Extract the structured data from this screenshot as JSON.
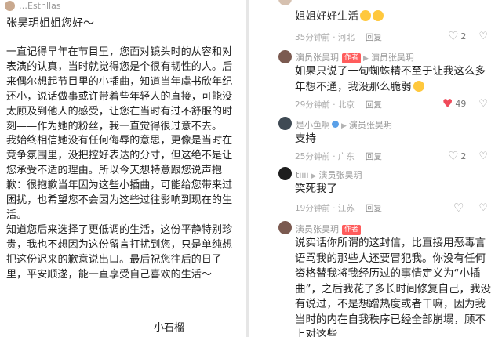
{
  "left_panel": {
    "top_name": "…Esthllas",
    "greeting": "张昊玥姐姐您好～",
    "paragraphs": [
      "一直记得早年在节目里，您面对镜头时的从容和对表演的认真，当时就觉得您是个很有韧性的人。后来偶尔想起节目里的小插曲，知道当年虞书欣年纪还小，说话做事或许带着些年轻人的直接，可能没太顾及到他人的感受，让您在当时有过不舒服的时刻——作为她的粉丝，我一直觉得很过意不去。",
      "我始终相信她没有任何侮辱的意思，更像是当时在竞争氛围里，没把控好表达的分寸，但这绝不是让您承受不适的理由。所以今天想特意跟您说声抱歉：很抱歉当年因为这些小插曲，可能给您带来过困扰，也希望您不会因为这些过往影响到现在的生活。",
      "知道您后来选择了更低调的生活，这份平静特别珍贵，我也不想因为这份留言打扰到您，只是单纯想把这份迟来的歉意说出口。最后祝您往后的日子里，平安顺遂，能一直享受自己喜欢的生活～"
    ],
    "signature": "——小石榴"
  },
  "comments": [
    {
      "name": "",
      "reply_to": "",
      "text": "姐姐好好生活",
      "time": "35分钟前 · 河北",
      "reply": "回复",
      "likes": "2",
      "liked": false,
      "avatar_color": "#d6c1b0"
    },
    {
      "name": "演员张昊玥",
      "author_tag": "作者",
      "reply_to": "演员张昊玥",
      "text": "如果只说了一句蜘蛛精不至于让我这么多年想不通，我没那么脆弱",
      "time": "29分钟前 · 北京",
      "reply": "回复",
      "likes": "49",
      "liked": true,
      "avatar_color": "#7b5a50"
    },
    {
      "name": "是小鱼啊",
      "author_tag": "",
      "reply_to": "演员张昊玥",
      "text": "支持",
      "time": "25分钟前 · 广东",
      "reply": "回复",
      "likes": "2",
      "liked": false,
      "avatar_color": "#3f4a54"
    },
    {
      "name": "tiiii",
      "author_tag": "",
      "reply_to": "演员张昊玥",
      "text": "笑死我了",
      "time": "19分钟前 · 江苏",
      "reply": "回复",
      "likes": "",
      "liked": false,
      "avatar_color": "#1e1e1e"
    },
    {
      "name": "演员张昊玥",
      "author_tag": "作者",
      "reply_to": "",
      "text": "说实话你所谓的这封信，比直接用恶毒言语骂我的那些人还要冒犯我。你没有任何资格替我将我经历过的事情定义为“小插曲”，之后我花了多长时间修复自己，我没有说过，不是想蹭热度或者干嘛，因为我当时的内在自我秩序已经全部崩塌，顾不上对这些",
      "time": "",
      "reply": "",
      "likes": "",
      "liked": false,
      "avatar_color": "#7b5a50"
    }
  ],
  "colors": {
    "author_tag": "#ff5c5c",
    "liked_heart": "#f04a5a",
    "meta_gray": "#a8a8a8"
  }
}
